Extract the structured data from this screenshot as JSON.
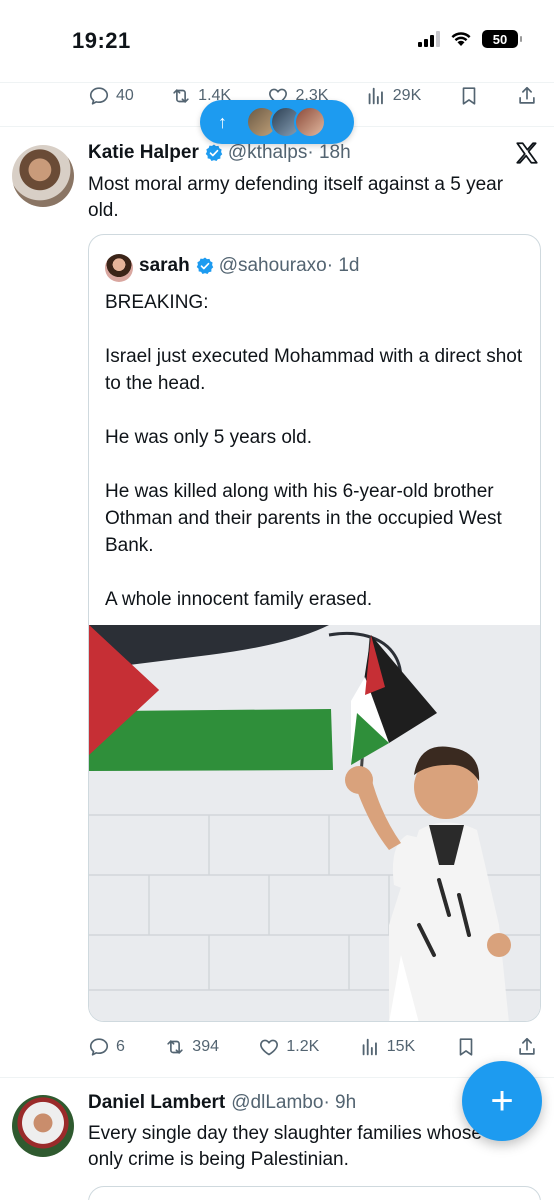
{
  "status_bar": {
    "time": "19:21",
    "battery": "50",
    "icons": [
      "signal-icon",
      "wifi-icon",
      "battery-icon"
    ]
  },
  "previous_tweet_actions": {
    "replies": "40",
    "reposts": "1.4K",
    "likes": "2.3K",
    "views": "29K"
  },
  "new_posts_pill": {
    "arrow": "↑",
    "avatars": 3
  },
  "tweet": {
    "author_name": "Katie Halper",
    "author_handle": "@kthalps",
    "time": "· 18h",
    "text": "Most moral army defending itself against a 5 year old."
  },
  "quote": {
    "author_name": "sarah",
    "author_handle": "@sahouraxo",
    "time": "· 1d",
    "text": "BREAKING:\n\nIsrael just executed Mohammad with a direct shot to the head.\n\nHe was only 5 years old.\n\nHe was killed along with his 6-year-old brother Othman and their parents in the occupied West Bank.\n\nA whole innocent family erased."
  },
  "tweet_actions": {
    "replies": "6",
    "reposts": "394",
    "likes": "1.2K",
    "views": "15K"
  },
  "tweet2": {
    "author_name": "Daniel Lambert",
    "author_handle": "@dlLambo",
    "time": "· 9h",
    "text": "Every single day they slaughter families whose only crime is being Palestinian."
  },
  "fab": {
    "label": "+"
  },
  "colors": {
    "accent": "#1d9bf0",
    "text": "#0f1419",
    "muted": "#536471",
    "border": "#cfd9de"
  }
}
